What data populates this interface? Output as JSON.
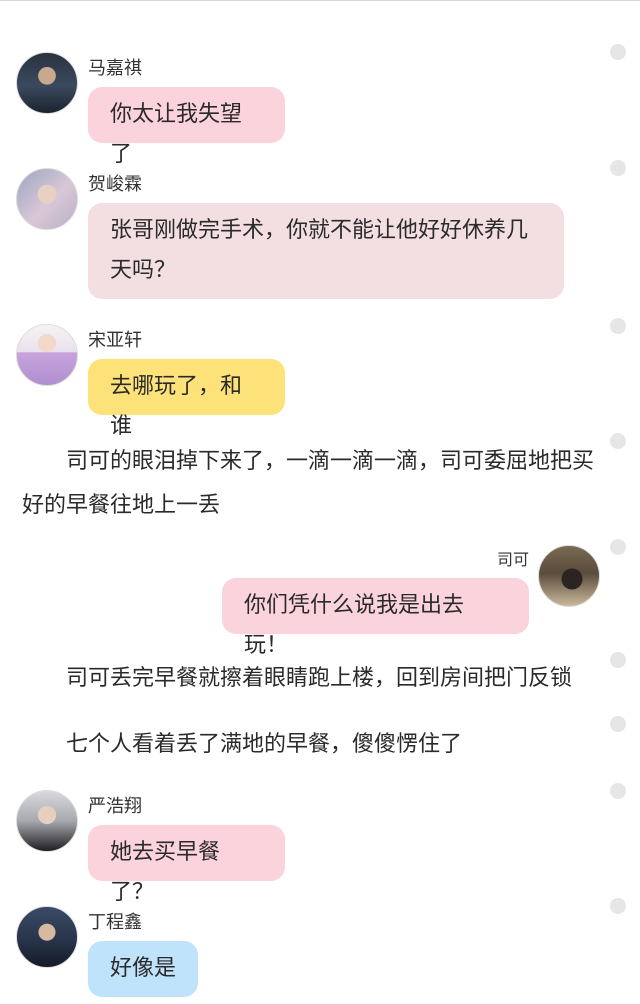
{
  "messages": [
    {
      "sender": "马嘉祺",
      "text": "你太让我失望了",
      "avatar_icon": "boy-dark-jacket-avatar",
      "bubble_color": "#fbd3dd"
    },
    {
      "sender": "贺峻霖",
      "text_line1": "张哥刚做完手术，你就不能让他好好休养几",
      "text_line2": "天吗？",
      "avatar_icon": "boy-light-portrait-avatar",
      "bubble_color": "#f3dfe2"
    },
    {
      "sender": "宋亚轩",
      "text": "去哪玩了，和谁",
      "avatar_icon": "boy-purple-vest-avatar",
      "bubble_color": "#fde27a"
    },
    {
      "sender": "司可",
      "text": "你们凭什么说我是出去玩！",
      "avatar_icon": "girl-silhouette-avatar",
      "bubble_color": "#fbd3dd"
    },
    {
      "sender": "严浩翔",
      "text": "她去买早餐了？",
      "avatar_icon": "boy-black-jacket-avatar",
      "bubble_color": "#fbd3dd"
    },
    {
      "sender": "丁程鑫",
      "text": "好像是",
      "avatar_icon": "boy-dark-coat-avatar",
      "bubble_color": "#bfe3fb"
    }
  ],
  "narration": {
    "n1_line1": "司可的眼泪掉下来了，一滴一滴一滴，司可委屈地把买",
    "n1_line2": "好的早餐往地上一丢",
    "n2": "司可丢完早餐就擦着眼睛跑上楼，回到房间把门反锁",
    "n3": "七个人看着丢了满地的早餐，傻傻愣住了"
  }
}
